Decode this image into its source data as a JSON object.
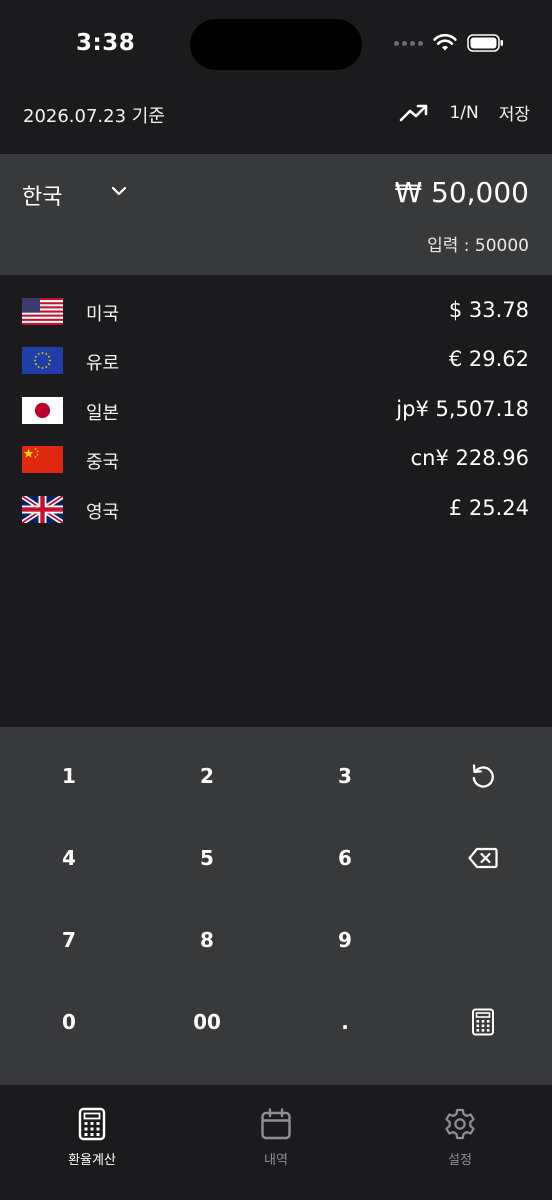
{
  "status_bar": {
    "time": "3:38"
  },
  "header": {
    "date_label": "2026.07.23 기준",
    "split_label": "1/N",
    "save_label": "저장",
    "trend_icon": "trending-up-icon"
  },
  "base": {
    "country": "한국",
    "amount": "₩ 50,000",
    "input_echo": "입력 : 50000"
  },
  "currencies": [
    {
      "country": "미국",
      "value": "$ 33.78",
      "flag": "us-flag-icon"
    },
    {
      "country": "유로",
      "value": "€ 29.62",
      "flag": "eu-flag-icon"
    },
    {
      "country": "일본",
      "value": "jp¥ 5,507.18",
      "flag": "jp-flag-icon"
    },
    {
      "country": "중국",
      "value": "cn¥ 228.96",
      "flag": "cn-flag-icon"
    },
    {
      "country": "영국",
      "value": "£ 25.24",
      "flag": "uk-flag-icon"
    }
  ],
  "keypad": {
    "k1": "1",
    "k2": "2",
    "k3": "3",
    "k4": "4",
    "k5": "5",
    "k6": "6",
    "k7": "7",
    "k8": "8",
    "k9": "9",
    "k0": "0",
    "k00": "00",
    "kdot": ".",
    "reset_icon": "reset-icon",
    "backspace_icon": "backspace-icon",
    "calculator_icon": "calculator-icon"
  },
  "tabs": [
    {
      "label": "환율계산",
      "icon": "calculator-icon",
      "active": true
    },
    {
      "label": "내역",
      "icon": "calendar-icon",
      "active": false
    },
    {
      "label": "설정",
      "icon": "gear-icon",
      "active": false
    }
  ],
  "colors": {
    "background": "#1b1b1d",
    "panel": "#38393a",
    "text": "#ffffff",
    "inactive_tab": "#8e8e93"
  }
}
